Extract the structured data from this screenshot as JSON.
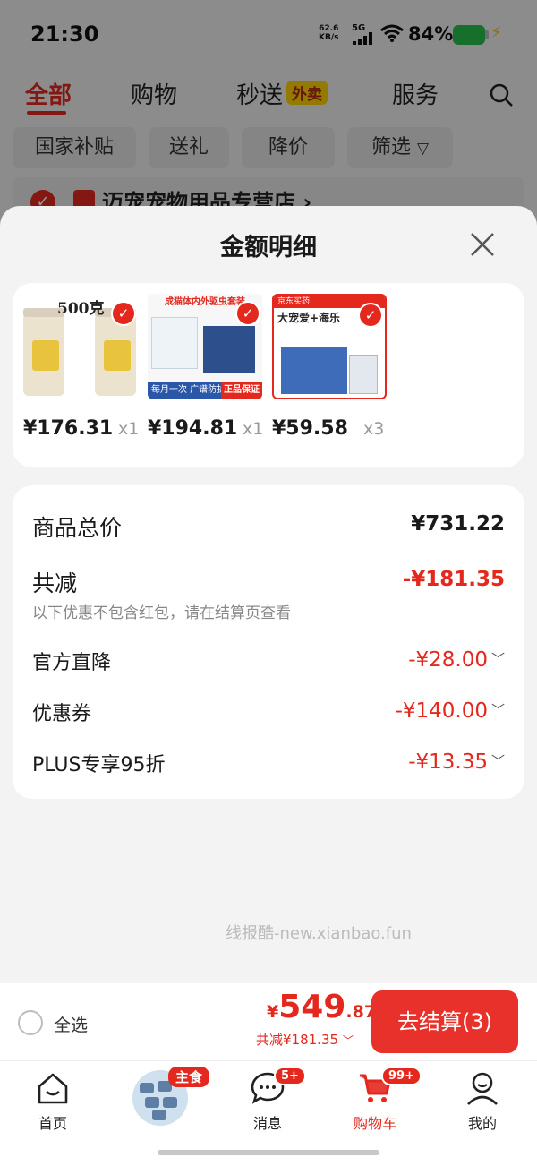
{
  "status_bar": {
    "time": "21:30",
    "net_speed": "62.6",
    "net_speed_unit": "KB/s",
    "network": "5G",
    "battery_pct": "84%"
  },
  "category_tabs": {
    "items": [
      "全部",
      "购物",
      "秒送",
      "服务"
    ],
    "active": "全部",
    "badge": "外卖"
  },
  "filters": [
    "国家补贴",
    "送礼",
    "降价",
    "筛选"
  ],
  "store": {
    "name": "迈宠宠物用品专营店 ›"
  },
  "sheet": {
    "title": "金额明细",
    "products": [
      {
        "price": "¥176.31",
        "qty": "x1",
        "image_text": "500克"
      },
      {
        "price": "¥194.81",
        "qty": "x1",
        "image_text": "成猫体内外驱虫套装",
        "banner": "每月一次 广谱防护",
        "banner_tag": "正品保证"
      },
      {
        "price": "¥59.58",
        "qty": "x3",
        "image_head": "京东买药",
        "image_title": "大宠爱+海乐"
      }
    ],
    "detail": {
      "total_label": "商品总价",
      "total_value": "¥731.22",
      "reduce_label": "共减",
      "reduce_value": "-¥181.35",
      "reduce_note": "以下优惠不包含红包，请在结算页查看",
      "rows": [
        {
          "label": "官方直降",
          "value": "-¥28.00"
        },
        {
          "label": "优惠券",
          "value": "-¥140.00"
        },
        {
          "label": "PLUS专享95折",
          "value": "-¥13.35"
        }
      ]
    },
    "watermark": "线报酷-new.xianbao.fun"
  },
  "checkout": {
    "select_all": "全选",
    "price_symbol": "¥",
    "price_int": "549",
    "price_dec": ".87",
    "discount": "共减¥181.35",
    "button": "去结算(3)"
  },
  "nav": {
    "items": [
      {
        "label": "首页"
      },
      {
        "badge": "主食"
      },
      {
        "label": "消息",
        "badge": "5+"
      },
      {
        "label": "购物车",
        "badge": "99+"
      },
      {
        "label": "我的"
      }
    ]
  },
  "colors": {
    "accent": "#e4281e",
    "button": "#e8312a",
    "overlay": "rgba(0,0,0,0.42)"
  }
}
